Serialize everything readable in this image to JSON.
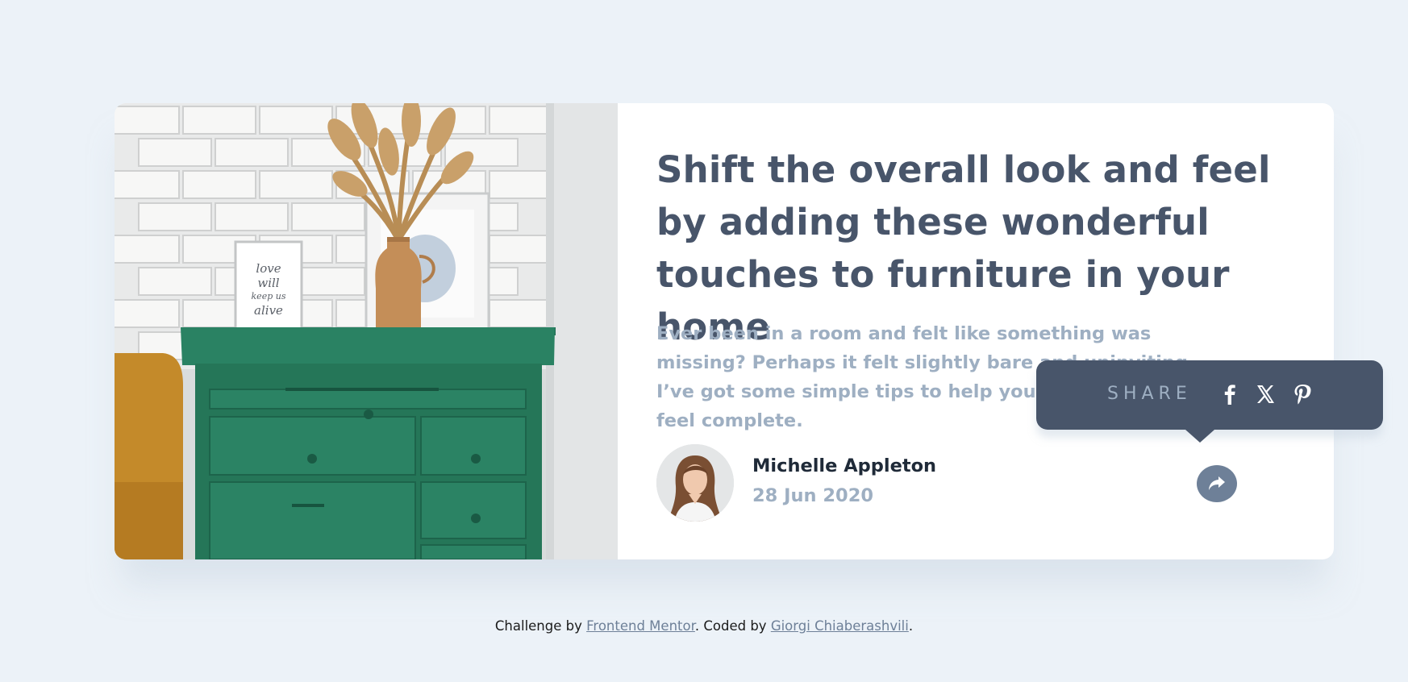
{
  "article": {
    "title": "Shift the overall look and feel by adding these wonderful touches to furniture in your home",
    "excerpt": "Ever been in a room and felt like something was missing? Perhaps it felt slightly bare and uninviting. I’ve got some simple tips to help you make any room feel complete."
  },
  "author": {
    "name": "Michelle Appleton",
    "date": "28 Jun 2020"
  },
  "share": {
    "label": "SHARE",
    "icons": [
      "facebook-icon",
      "x-icon",
      "pinterest-icon"
    ]
  },
  "artwork": {
    "frame_text": [
      "love",
      "will",
      "keep us",
      "alive"
    ]
  },
  "footer": {
    "prefix": "Challenge by ",
    "link1": "Frontend Mentor",
    "middle": ". Coded by ",
    "link2": "Giorgi Chiaberashvili",
    "suffix": "."
  },
  "colors": {
    "background": "#ecf2f8",
    "heading": "#48556a",
    "muted": "#9eafc2",
    "accent": "#6e8098",
    "tooltip": "#48556a"
  }
}
